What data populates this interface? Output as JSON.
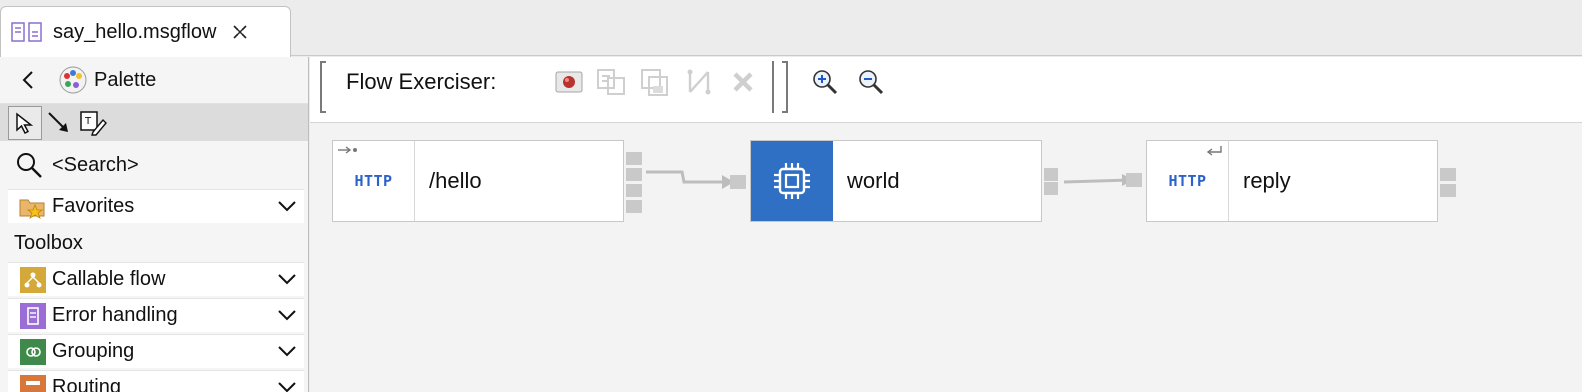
{
  "tab": {
    "title": "say_hello.msgflow"
  },
  "palette": {
    "title": "Palette",
    "search_placeholder": "<Search>",
    "favorites": "Favorites",
    "toolbox_header": "Toolbox",
    "drawers": [
      {
        "label": "Callable flow",
        "color": "#d4a93a"
      },
      {
        "label": "Error handling",
        "color": "#9a6ed6"
      },
      {
        "label": "Grouping",
        "color": "#3f8a4b"
      },
      {
        "label": "Routing",
        "color": "#d9763a"
      }
    ]
  },
  "toolbar": {
    "flow_exerciser_label": "Flow Exerciser:"
  },
  "nodes": [
    {
      "icon_text": "HTTP",
      "label": "/hello"
    },
    {
      "icon_text": "",
      "label": "world",
      "accent": "#2f6fc4"
    },
    {
      "icon_text": "HTTP",
      "label": "reply"
    }
  ]
}
